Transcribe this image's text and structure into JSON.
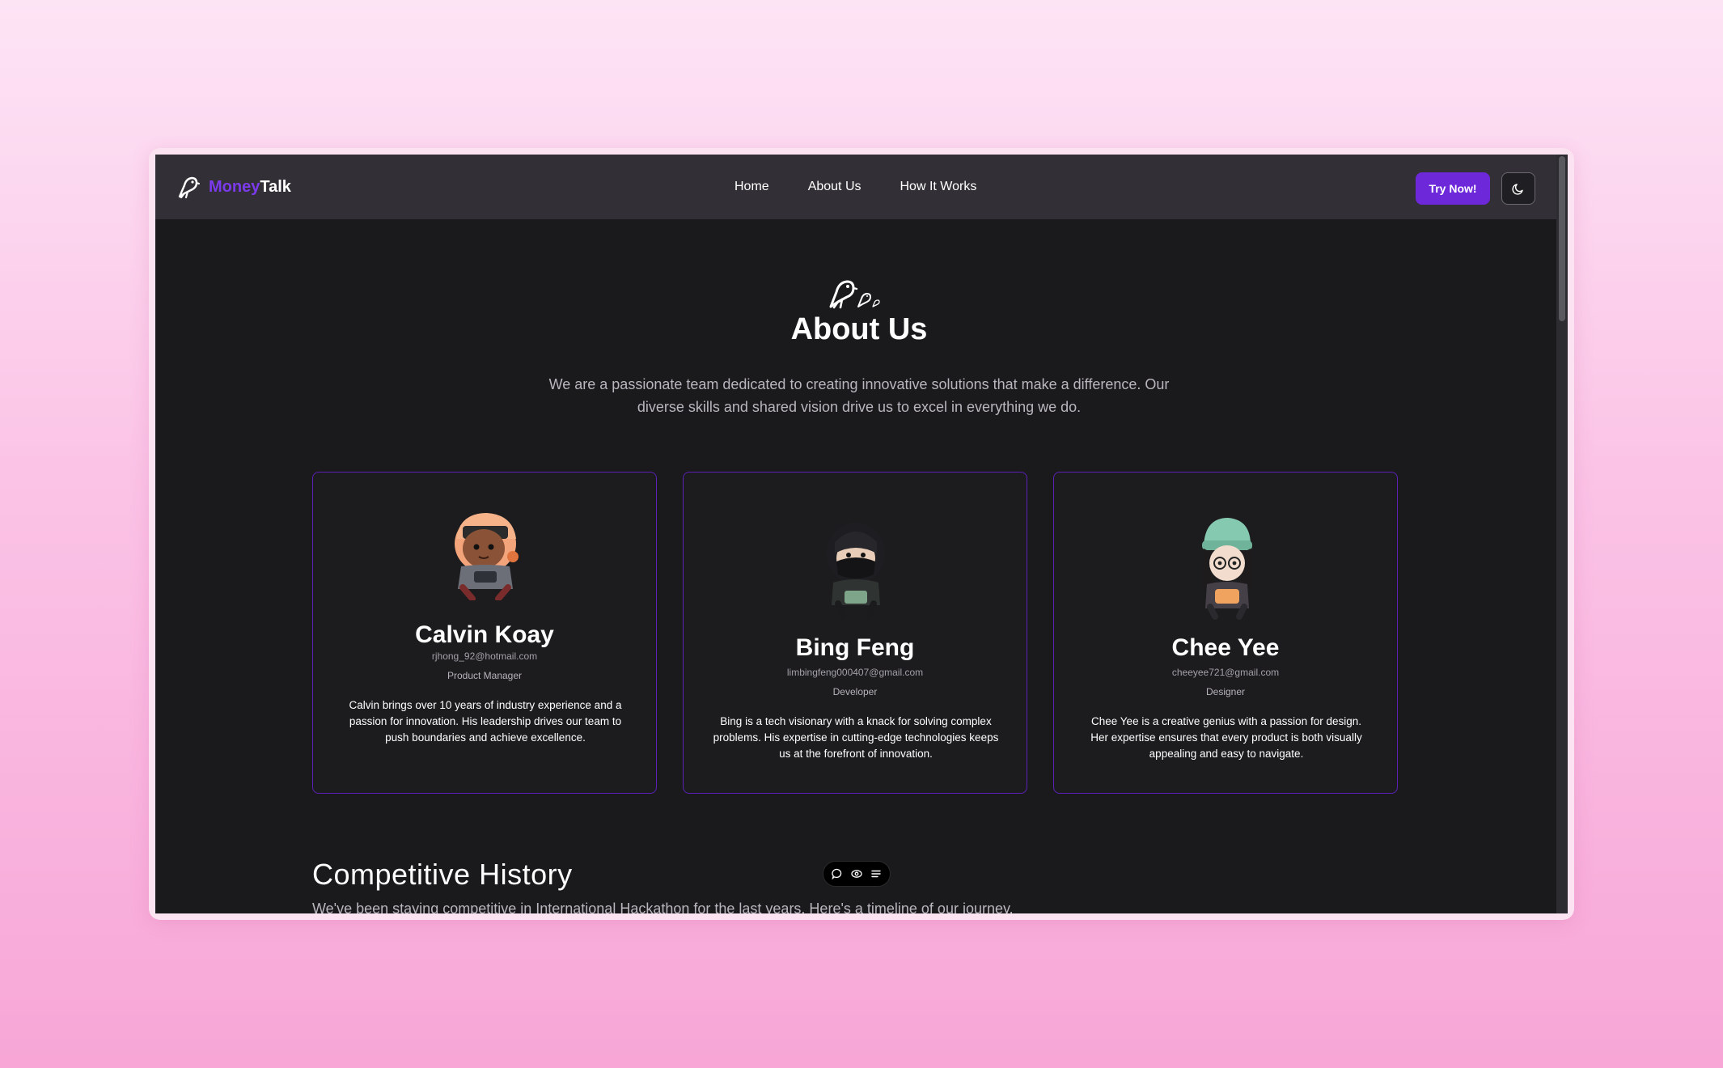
{
  "navbar": {
    "brand_part1": "Money",
    "brand_part2": "Talk",
    "links": [
      "Home",
      "About Us",
      "How It Works"
    ],
    "cta_label": "Try Now!",
    "theme_toggle_icon": "moon-icon"
  },
  "hero": {
    "icon": "birds-logo-icon",
    "title": "About Us",
    "description": "We are a passionate team dedicated to creating innovative solutions that make a difference. Our diverse skills and shared vision drive us to excel in everything we do."
  },
  "team": [
    {
      "name": "Calvin Koay",
      "email": "rjhong_92@hotmail.com",
      "role": "Product Manager",
      "bio": "Calvin brings over 10 years of industry experience and a passion for innovation. His leadership drives our team to push boundaries and achieve excellence.",
      "avatar": "cartoon-avatar-orange-cap"
    },
    {
      "name": "Bing Feng",
      "email": "limbingfeng000407@gmail.com",
      "role": "Developer",
      "bio": "Bing is a tech visionary with a knack for solving complex problems. His expertise in cutting-edge technologies keeps us at the forefront of innovation.",
      "avatar": "cartoon-avatar-black-mask"
    },
    {
      "name": "Chee Yee",
      "email": "cheeyee721@gmail.com",
      "role": "Designer",
      "bio": "Chee Yee is a creative genius with a passion for design. Her expertise ensures that every product is both visually appealing and easy to navigate.",
      "avatar": "cartoon-avatar-green-beanie"
    }
  ],
  "history": {
    "title": "Competitive History",
    "subtitle": "We've been staying competitive in International Hackathon for the last years. Here's a timeline of our journey."
  },
  "float_toolbar": [
    "chat-icon",
    "eye-icon",
    "list-icon"
  ],
  "colors": {
    "accent": "#6d28d9",
    "brand_accent": "#7c3aed",
    "page_bg": "#1a191c",
    "navbar_bg": "#323036"
  }
}
